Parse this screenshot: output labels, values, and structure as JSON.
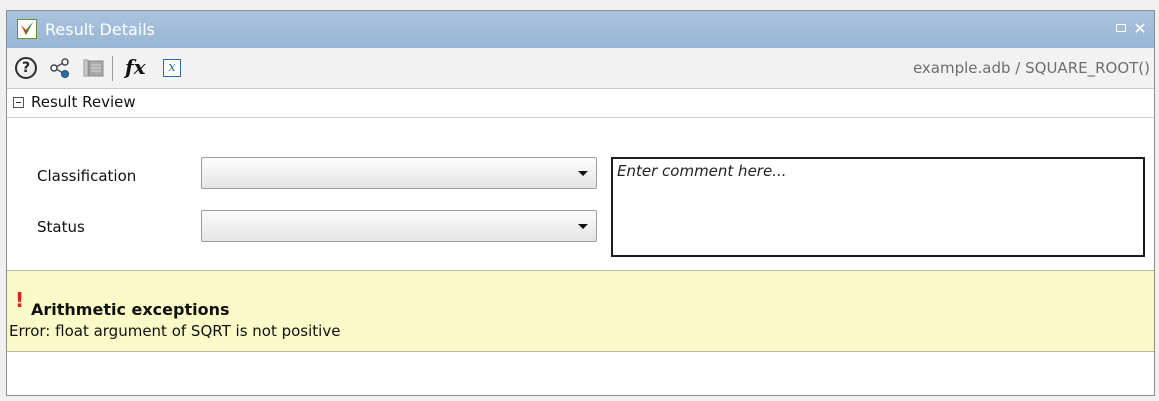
{
  "window": {
    "title": "Result Details"
  },
  "toolbar": {
    "help_icon": "help-icon",
    "breadcrumb": "example.adb / SQUARE_ROOT()"
  },
  "review": {
    "section_title": "Result Review",
    "classification_label": "Classification",
    "status_label": "Status",
    "classification_value": "",
    "status_value": "",
    "comment_placeholder": "Enter comment here..."
  },
  "result": {
    "title": "Arithmetic exceptions",
    "detail": "Error: float argument of SQRT is not positive"
  },
  "colors": {
    "titlebar": "#9fbbd8",
    "message_background": "#fafac8",
    "error_mark": "#e02020"
  }
}
